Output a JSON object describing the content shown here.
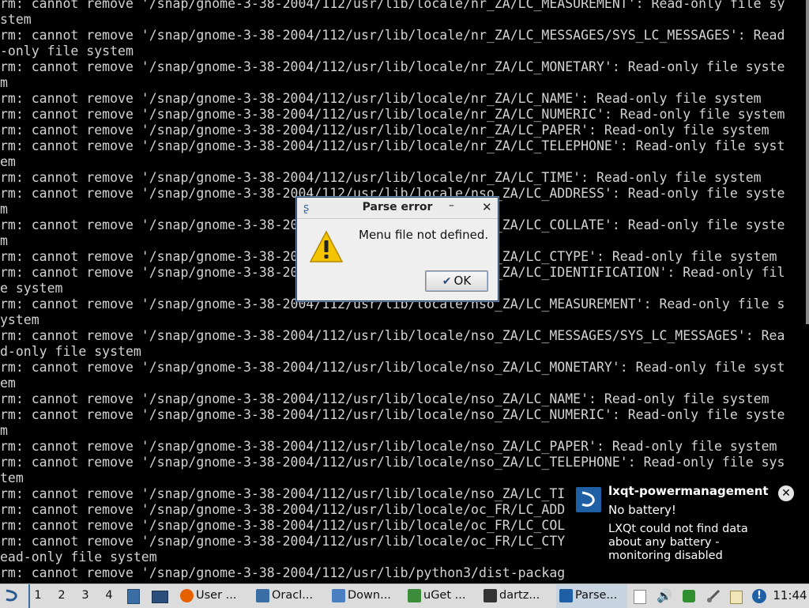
{
  "terminal": {
    "lines": [
      "rm: cannot remove '/snap/gnome-3-38-2004/112/usr/lib/locale/nr_ZA/LC_MEASUREMENT': Read-only file sy",
      "stem",
      "rm: cannot remove '/snap/gnome-3-38-2004/112/usr/lib/locale/nr_ZA/LC_MESSAGES/SYS_LC_MESSAGES': Read",
      "-only file system",
      "rm: cannot remove '/snap/gnome-3-38-2004/112/usr/lib/locale/nr_ZA/LC_MONETARY': Read-only file syste",
      "m",
      "rm: cannot remove '/snap/gnome-3-38-2004/112/usr/lib/locale/nr_ZA/LC_NAME': Read-only file system",
      "rm: cannot remove '/snap/gnome-3-38-2004/112/usr/lib/locale/nr_ZA/LC_NUMERIC': Read-only file system",
      "rm: cannot remove '/snap/gnome-3-38-2004/112/usr/lib/locale/nr_ZA/LC_PAPER': Read-only file system",
      "rm: cannot remove '/snap/gnome-3-38-2004/112/usr/lib/locale/nr_ZA/LC_TELEPHONE': Read-only file syst",
      "em",
      "rm: cannot remove '/snap/gnome-3-38-2004/112/usr/lib/locale/nr_ZA/LC_TIME': Read-only file system",
      "rm: cannot remove '/snap/gnome-3-38-2004/112/usr/lib/locale/nso_ZA/LC_ADDRESS': Read-only file syste",
      "m",
      "rm: cannot remove '/snap/gnome-3-38-2004/112/usr/lib/locale/nso_ZA/LC_COLLATE': Read-only file syste",
      "m",
      "rm: cannot remove '/snap/gnome-3-38-2004/112/usr/lib/locale/nso_ZA/LC_CTYPE': Read-only file system",
      "rm: cannot remove '/snap/gnome-3-38-2004/112/usr/lib/locale/nso_ZA/LC_IDENTIFICATION': Read-only fil",
      "e system",
      "rm: cannot remove '/snap/gnome-3-38-2004/112/usr/lib/locale/nso_ZA/LC_MEASUREMENT': Read-only file s",
      "ystem",
      "rm: cannot remove '/snap/gnome-3-38-2004/112/usr/lib/locale/nso_ZA/LC_MESSAGES/SYS_LC_MESSAGES': Rea",
      "d-only file system",
      "rm: cannot remove '/snap/gnome-3-38-2004/112/usr/lib/locale/nso_ZA/LC_MONETARY': Read-only file syst",
      "em",
      "rm: cannot remove '/snap/gnome-3-38-2004/112/usr/lib/locale/nso_ZA/LC_NAME': Read-only file system",
      "rm: cannot remove '/snap/gnome-3-38-2004/112/usr/lib/locale/nso_ZA/LC_NUMERIC': Read-only file syste",
      "m",
      "rm: cannot remove '/snap/gnome-3-38-2004/112/usr/lib/locale/nso_ZA/LC_PAPER': Read-only file system",
      "rm: cannot remove '/snap/gnome-3-38-2004/112/usr/lib/locale/nso_ZA/LC_TELEPHONE': Read-only file sys",
      "tem",
      "rm: cannot remove '/snap/gnome-3-38-2004/112/usr/lib/locale/nso_ZA/LC_TI",
      "rm: cannot remove '/snap/gnome-3-38-2004/112/usr/lib/locale/oc_FR/LC_ADD",
      "rm: cannot remove '/snap/gnome-3-38-2004/112/usr/lib/locale/oc_FR/LC_COL",
      "rm: cannot remove '/snap/gnome-3-38-2004/112/usr/lib/locale/oc_FR/LC_CTY",
      "ead-only file system",
      "rm: cannot remove '/snap/gnome-3-38-2004/112/usr/lib/python3/dist-packag"
    ]
  },
  "dialog": {
    "title": "Parse error",
    "min_glyph": "–",
    "close_glyph": "✕",
    "message": "Menu file not defined.",
    "ok_label": "OK",
    "ok_glyph": "✔"
  },
  "notification": {
    "app": "lxqt-powermanagement",
    "summary": "No battery!",
    "body": "LXQt could not find data about any battery - monitoring disabled",
    "close_glyph": "✕"
  },
  "taskbar": {
    "workspaces": [
      "1",
      "2",
      "3",
      "4"
    ],
    "tasks": [
      {
        "label": "User ...",
        "color": "#e66000"
      },
      {
        "label": "Oracl...",
        "color": "#3a6ea5"
      },
      {
        "label": "Down...",
        "color": "#4a7fc1"
      },
      {
        "label": "uGet ...",
        "color": "#3c8c3c"
      },
      {
        "label": "dartz...",
        "color": "#333333"
      },
      {
        "label": "Parse...",
        "color": "#1f5fa3"
      }
    ],
    "clock": "11:44"
  }
}
